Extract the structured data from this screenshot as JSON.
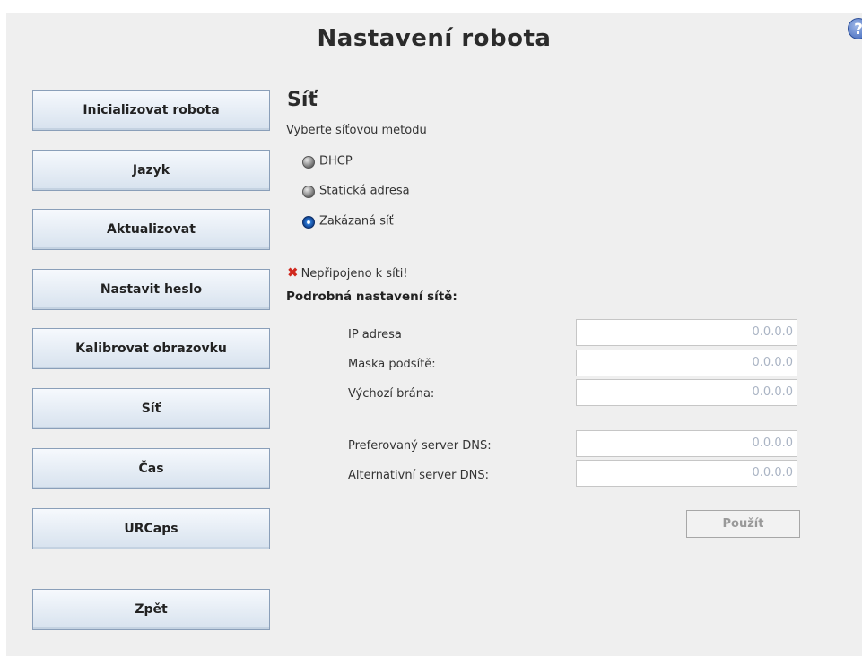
{
  "header": {
    "title": "Nastavení robota",
    "help_icon": "help-icon"
  },
  "nav": {
    "items": [
      {
        "label": "Inicializovat robota"
      },
      {
        "label": "Jazyk"
      },
      {
        "label": "Aktualizovat"
      },
      {
        "label": "Nastavit heslo"
      },
      {
        "label": "Kalibrovat obrazovku"
      },
      {
        "label": "Síť"
      },
      {
        "label": "Čas"
      },
      {
        "label": "URCaps"
      }
    ],
    "back": {
      "label": "Zpět"
    }
  },
  "network": {
    "title": "Síť",
    "method_prompt": "Vyberte síťovou metodu",
    "methods": [
      {
        "label": "DHCP",
        "selected": false
      },
      {
        "label": "Statická adresa",
        "selected": false
      },
      {
        "label": "Zakázaná síť",
        "selected": true
      }
    ],
    "status": "Nepřipojeno k síti!",
    "status_icon": "error-x-icon",
    "details_title": "Podrobná nastavení sítě:",
    "fields": [
      {
        "label": "IP adresa",
        "value": "0.0.0.0"
      },
      {
        "label": "Maska podsítě:",
        "value": "0.0.0.0"
      },
      {
        "label": "Výchozí brána:",
        "value": "0.0.0.0"
      },
      {
        "label": "Preferovaný server DNS:",
        "value": "0.0.0.0"
      },
      {
        "label": "Alternativní server DNS:",
        "value": "0.0.0.0"
      }
    ],
    "apply_label": "Použít"
  },
  "colors": {
    "accent_line": "#7a94b6",
    "selected_radio": "#2c79d4",
    "error": "#d0281e"
  }
}
